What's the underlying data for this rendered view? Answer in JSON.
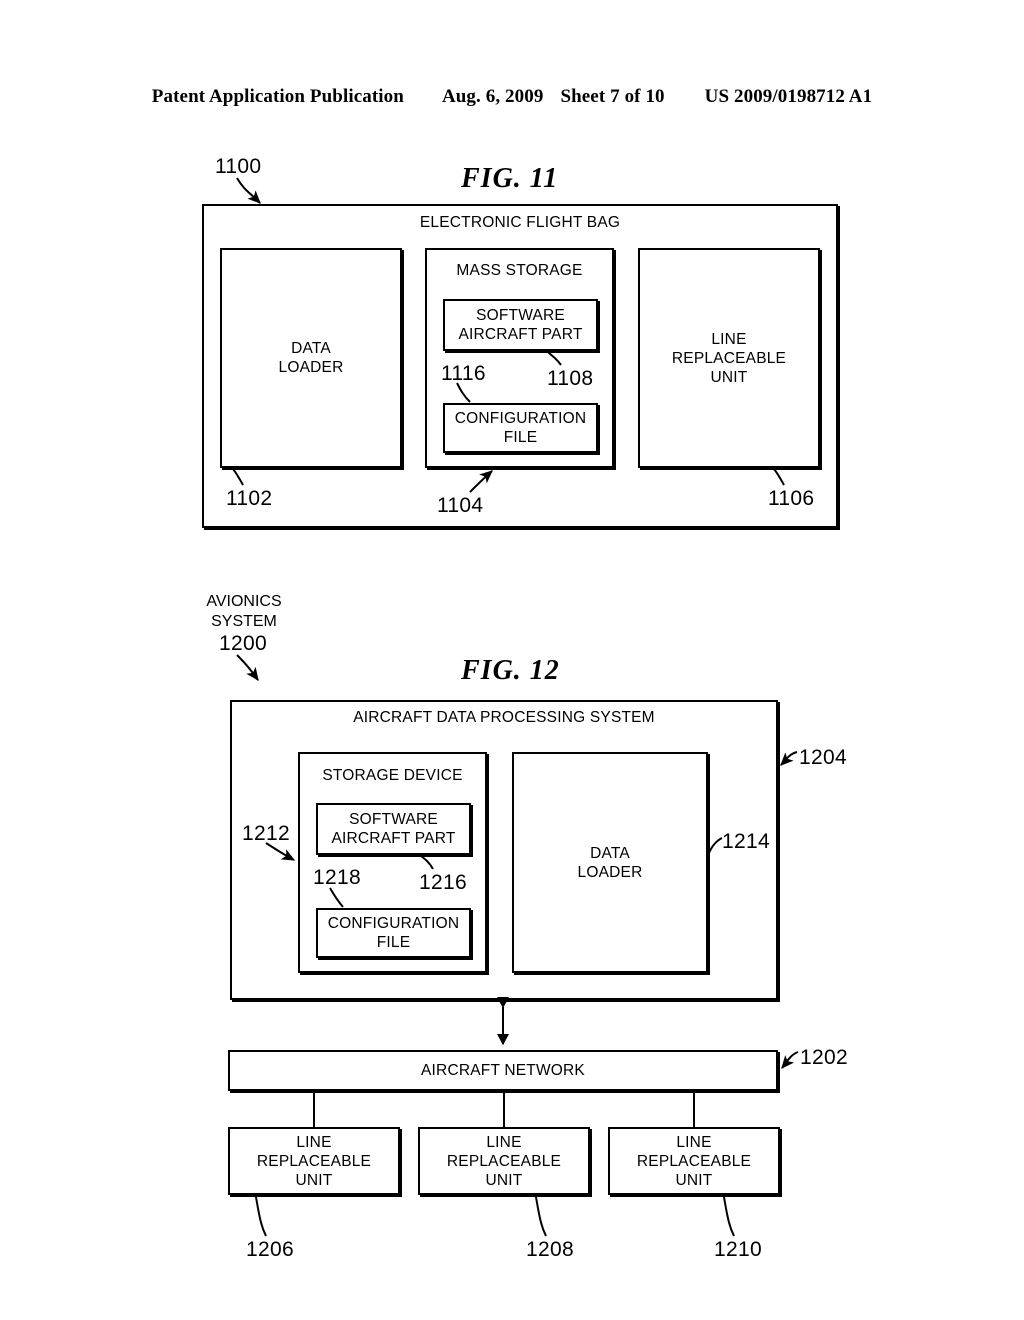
{
  "header": {
    "title": "Patent Application Publication",
    "date": "Aug. 6, 2009",
    "sheet": "Sheet 7 of 10",
    "pub_number": "US 2009/0198712 A1"
  },
  "figures": [
    {
      "title": "FIG. 11",
      "system_ref": "1100",
      "outer": {
        "label": "ELECTRONIC FLIGHT BAG"
      },
      "blocks": [
        {
          "name": "data-loader",
          "label": "DATA\nLOADER",
          "ref": "1102"
        },
        {
          "name": "mass-storage",
          "label": "MASS STORAGE",
          "ref": "1104"
        },
        {
          "name": "line-replaceable-unit",
          "label": "LINE\nREPLACEABLE\nUNIT",
          "ref": "1106"
        }
      ],
      "inner_blocks": [
        {
          "name": "software-aircraft-part",
          "label": "SOFTWARE\nAIRCRAFT PART",
          "ref": "1108"
        },
        {
          "name": "configuration-file",
          "label": "CONFIGURATION\nFILE",
          "ref": "1116"
        }
      ]
    },
    {
      "title": "FIG. 12",
      "system_label": "AVIONICS\nSYSTEM",
      "system_ref": "1200",
      "outer": {
        "label": "AIRCRAFT DATA PROCESSING SYSTEM",
        "ref": "1204"
      },
      "blocks": [
        {
          "name": "storage-device",
          "label": "STORAGE DEVICE",
          "ref": "1212"
        },
        {
          "name": "data-loader",
          "label": "DATA\nLOADER",
          "ref": "1214"
        }
      ],
      "inner_blocks": [
        {
          "name": "software-aircraft-part",
          "label": "SOFTWARE\nAIRCRAFT PART",
          "ref": "1216"
        },
        {
          "name": "configuration-file",
          "label": "CONFIGURATION\nFILE",
          "ref": "1218"
        }
      ],
      "network": {
        "name": "aircraft-network",
        "label": "AIRCRAFT NETWORK",
        "ref": "1202"
      },
      "lrus": [
        {
          "name": "line-replaceable-unit-1",
          "label": "LINE\nREPLACEABLE\nUNIT",
          "ref": "1206"
        },
        {
          "name": "line-replaceable-unit-2",
          "label": "LINE\nREPLACEABLE\nUNIT",
          "ref": "1208"
        },
        {
          "name": "line-replaceable-unit-3",
          "label": "LINE\nREPLACEABLE\nUNIT",
          "ref": "1210"
        }
      ]
    }
  ]
}
